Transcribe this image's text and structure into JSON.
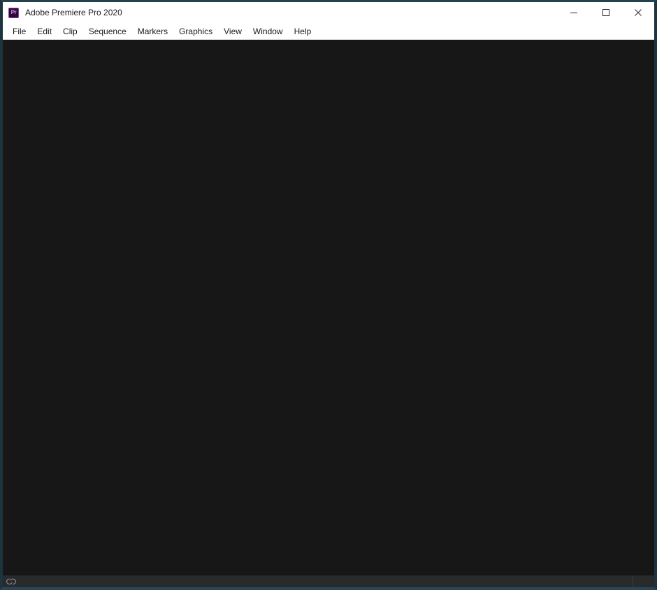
{
  "window": {
    "title": "Adobe Premiere Pro 2020",
    "app_icon_label": "Pr",
    "icon_name": "premiere-pro-icon",
    "accent_color": "#9b4dca",
    "icon_bg_color": "#2d0a36",
    "titlebar_bg": "#ffffff",
    "workspace_bg": "#171717",
    "statusbar_bg": "#282a2b",
    "border_color": "#24414f"
  },
  "window_controls": [
    {
      "name": "minimize-button",
      "label": "Minimize",
      "glyph": "minimize"
    },
    {
      "name": "maximize-button",
      "label": "Maximize",
      "glyph": "maximize"
    },
    {
      "name": "close-button",
      "label": "Close",
      "glyph": "close"
    }
  ],
  "menu": {
    "items": [
      {
        "label": "File"
      },
      {
        "label": "Edit"
      },
      {
        "label": "Clip"
      },
      {
        "label": "Sequence"
      },
      {
        "label": "Markers"
      },
      {
        "label": "Graphics"
      },
      {
        "label": "View"
      },
      {
        "label": "Window"
      },
      {
        "label": "Help"
      }
    ]
  },
  "workspace": {
    "content": ""
  },
  "status_bar": {
    "cc_icon_name": "creative-cloud-icon",
    "cc_icon_label": "Creative Cloud",
    "text": ""
  }
}
